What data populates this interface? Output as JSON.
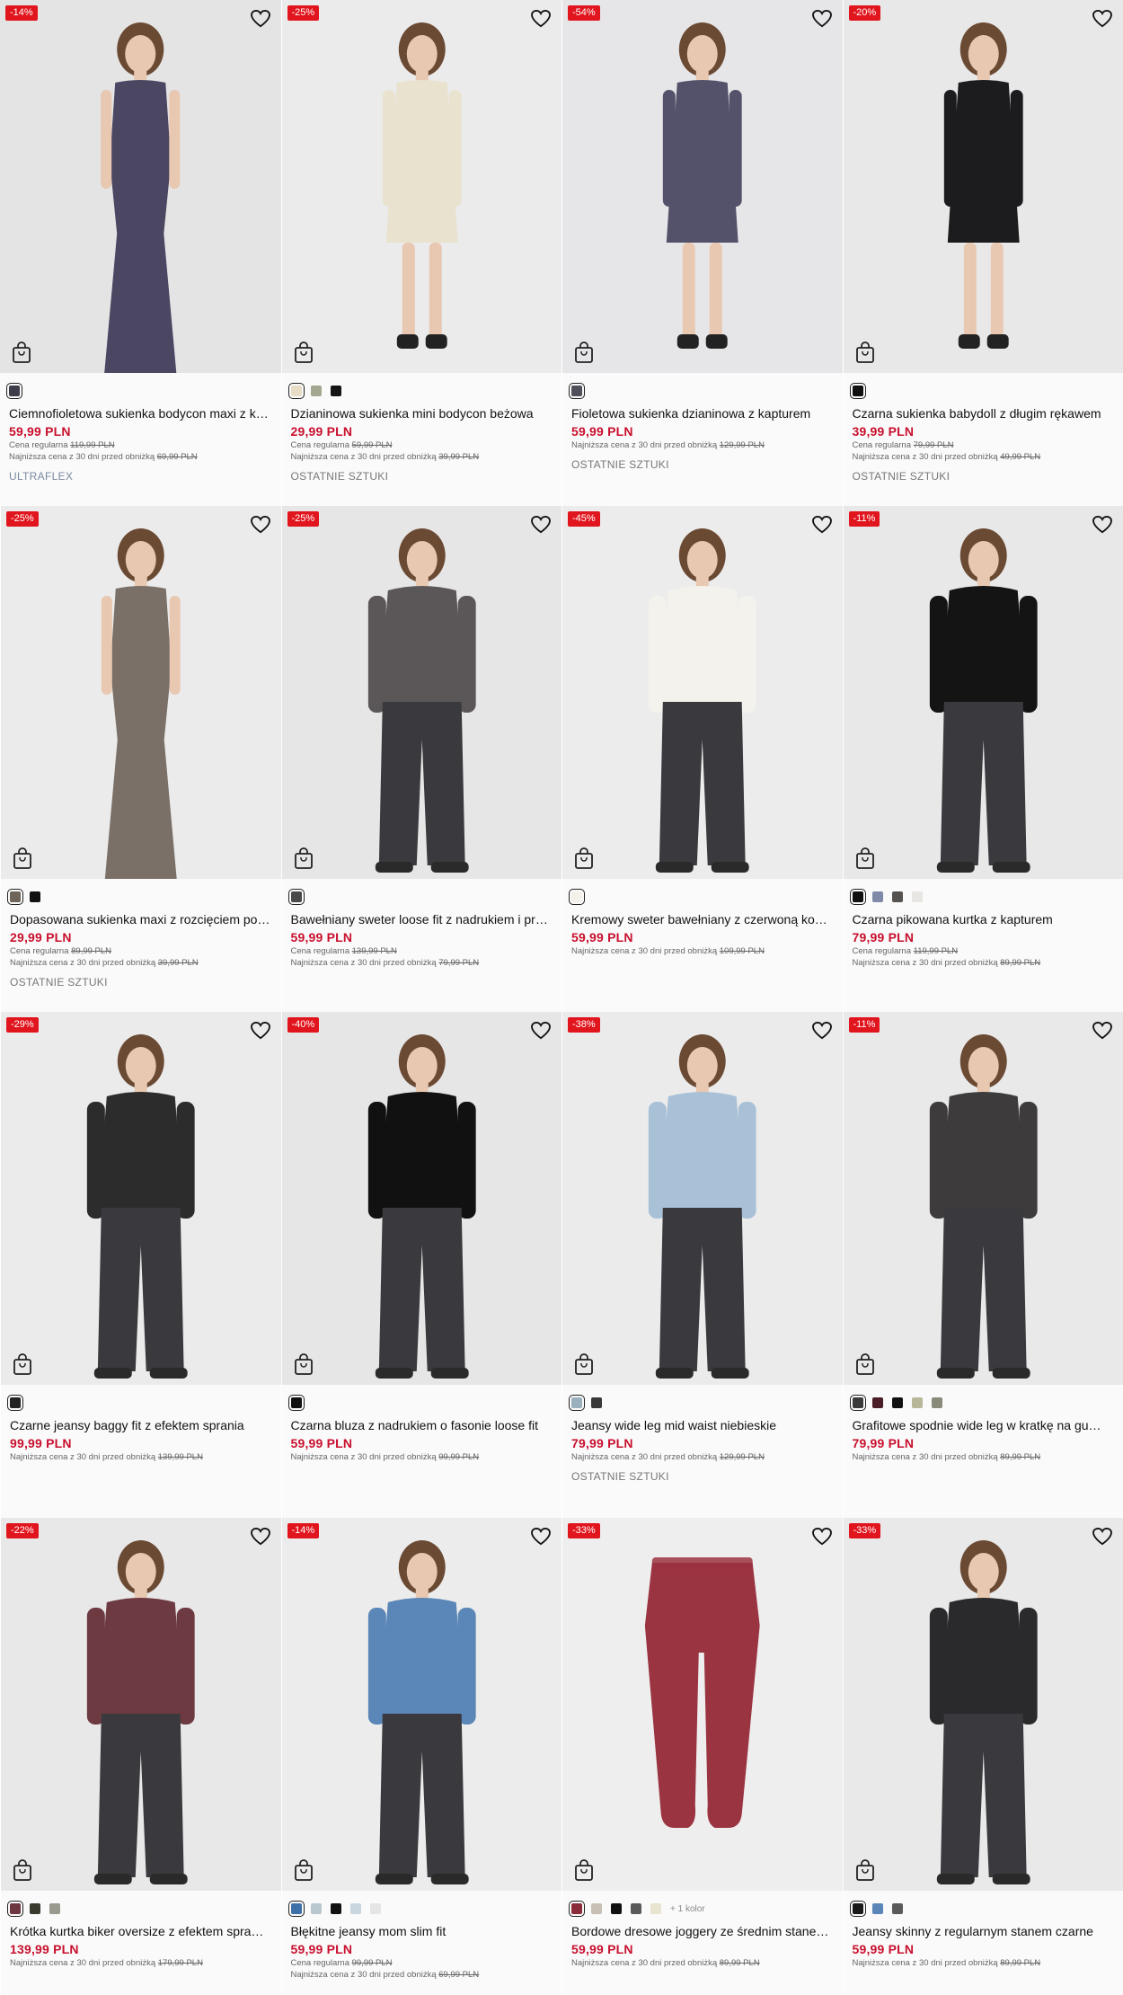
{
  "colors": {
    "badge": "#e1151d",
    "price": "#c8102e"
  },
  "labels": {
    "regular": "Cena regularna",
    "lowest": "Najniższa cena z 30 dni przed obniżką"
  },
  "products": [
    {
      "discount": "-14%",
      "name": "Ciemnofioletowa sukienka bodycon maxi z k…",
      "price": "59,99 PLN",
      "regular": "119,99 PLN",
      "lowest": "69,99 PLN",
      "tag": "ULTRAFLEX",
      "swatches": [
        "#3e3e4a"
      ],
      "more": "",
      "bg": "#e4e4e4",
      "garment": "#4b4762",
      "style": "dress-long"
    },
    {
      "discount": "-25%",
      "name": "Dzianinowa sukienka mini bodycon beżowa",
      "price": "29,99 PLN",
      "regular": "59,99 PLN",
      "lowest": "39,99 PLN",
      "tag": "OSTATNIE SZTUKI",
      "swatches": [
        "#e7dcc6",
        "#a5a890",
        "#151515"
      ],
      "more": "",
      "bg": "#ebebec",
      "garment": "#e9e2cf",
      "style": "dress-short"
    },
    {
      "discount": "-54%",
      "name": "Fioletowa sukienka dzianinowa z kapturem",
      "price": "59,99 PLN",
      "regular": "",
      "lowest": "129,99 PLN",
      "tag": "OSTATNIE SZTUKI",
      "swatches": [
        "#50505a"
      ],
      "more": "",
      "bg": "#e6e6e8",
      "garment": "#54526b",
      "style": "dress-short"
    },
    {
      "discount": "-20%",
      "name": "Czarna sukienka babydoll z długim rękawem",
      "price": "39,99 PLN",
      "regular": "79,99 PLN",
      "lowest": "49,99 PLN",
      "tag": "OSTATNIE SZTUKI",
      "swatches": [
        "#111111"
      ],
      "more": "",
      "bg": "#e8e8e9",
      "garment": "#1c1c1f",
      "style": "dress-short"
    },
    {
      "discount": "-25%",
      "name": "Dopasowana sukienka maxi z rozcięciem po…",
      "price": "29,99 PLN",
      "regular": "89,99 PLN",
      "lowest": "39,99 PLN",
      "tag": "OSTATNIE SZTUKI",
      "swatches": [
        "#6e645a",
        "#111111"
      ],
      "more": "",
      "bg": "#ebebeb",
      "garment": "#7a7068",
      "style": "dress-long"
    },
    {
      "discount": "-25%",
      "name": "Bawełniany sweter loose fit z nadrukiem i pr…",
      "price": "59,99 PLN",
      "regular": "139,99 PLN",
      "lowest": "79,99 PLN",
      "tag": "",
      "swatches": [
        "#4a4848"
      ],
      "more": "",
      "bg": "#e7e6e6",
      "garment": "#5b5758",
      "style": "top-pants"
    },
    {
      "discount": "-45%",
      "name": "Kremowy sweter bawełniany z czerwoną ko…",
      "price": "59,99 PLN",
      "regular": "",
      "lowest": "109,99 PLN",
      "tag": "",
      "swatches": [
        "#f3f1ea"
      ],
      "more": "",
      "bg": "#ececec",
      "garment": "#f4f2ec",
      "style": "top-pants"
    },
    {
      "discount": "-11%",
      "name": "Czarna pikowana kurtka z kapturem",
      "price": "79,99 PLN",
      "regular": "119,99 PLN",
      "lowest": "89,99 PLN",
      "tag": "",
      "swatches": [
        "#111111",
        "#7f8aa8",
        "#55524f",
        "#e8e6e2"
      ],
      "more": "",
      "bg": "#e8e8e8",
      "garment": "#141414",
      "style": "top-pants"
    },
    {
      "discount": "-29%",
      "name": "Czarne jeansy baggy fit z efektem sprania",
      "price": "99,99 PLN",
      "regular": "",
      "lowest": "139,99 PLN",
      "tag": "",
      "swatches": [
        "#222222"
      ],
      "more": "",
      "bg": "#ebebeb",
      "garment": "#2c2c2c",
      "style": "top-pants"
    },
    {
      "discount": "-40%",
      "name": "Czarna bluza z nadrukiem o fasonie loose fit",
      "price": "59,99 PLN",
      "regular": "",
      "lowest": "99,99 PLN",
      "tag": "",
      "swatches": [
        "#111111"
      ],
      "more": "",
      "bg": "#e6e6e6",
      "garment": "#111111",
      "style": "top-pants"
    },
    {
      "discount": "-38%",
      "name": "Jeansy wide leg mid waist niebieskie",
      "price": "79,99 PLN",
      "regular": "",
      "lowest": "129,99 PLN",
      "tag": "OSTATNIE SZTUKI",
      "swatches": [
        "#9bb0bd",
        "#3a3a3a"
      ],
      "more": "",
      "bg": "#ebebec",
      "garment": "#a9c1d6",
      "style": "top-pants"
    },
    {
      "discount": "-11%",
      "name": "Grafitowe spodnie wide leg w kratkę na gu…",
      "price": "79,99 PLN",
      "regular": "",
      "lowest": "89,99 PLN",
      "tag": "",
      "swatches": [
        "#3a3a3a",
        "#4a1f25",
        "#111111",
        "#b9b79a",
        "#8a8a7a"
      ],
      "more": "",
      "bg": "#e9e9e9",
      "garment": "#3d3b3b",
      "style": "top-pants"
    },
    {
      "discount": "-22%",
      "name": "Krótka kurtka biker oversize z efektem spra…",
      "price": "139,99 PLN",
      "regular": "",
      "lowest": "179,99 PLN",
      "tag": "",
      "swatches": [
        "#6e3640",
        "#3a3a2e",
        "#9a9a8e"
      ],
      "more": "",
      "bg": "#e8e8e8",
      "garment": "#6e3a42",
      "style": "top-pants"
    },
    {
      "discount": "-14%",
      "name": "Błękitne jeansy mom slim fit",
      "price": "59,99 PLN",
      "regular": "99,99 PLN",
      "lowest": "69,99 PLN",
      "tag": "",
      "swatches": [
        "#3d6fa8",
        "#b9c7cf",
        "#111111",
        "#c9d6e0",
        "#e5e5e5"
      ],
      "more": "",
      "bg": "#ececec",
      "garment": "#5b86b8",
      "style": "top-pants"
    },
    {
      "discount": "-33%",
      "name": "Bordowe dresowe joggery ze średnim stane…",
      "price": "59,99 PLN",
      "regular": "",
      "lowest": "89,99 PLN",
      "tag": "",
      "swatches": [
        "#8a2c3a",
        "#c8c0b4",
        "#111111",
        "#5a5a5a",
        "#e9e4cf"
      ],
      "more": "+ 1 kolor",
      "bg": "#eeeeee",
      "garment": "#9a3440",
      "style": "pants-only"
    },
    {
      "discount": "-33%",
      "name": "Jeansy skinny z regularnym stanem czarne",
      "price": "59,99 PLN",
      "regular": "",
      "lowest": "89,99 PLN",
      "tag": "",
      "swatches": [
        "#1a1a1a",
        "#5b86b8",
        "#5a5a5a"
      ],
      "more": "",
      "bg": "#e9e9e9",
      "garment": "#2a2a2c",
      "style": "top-pants"
    }
  ]
}
